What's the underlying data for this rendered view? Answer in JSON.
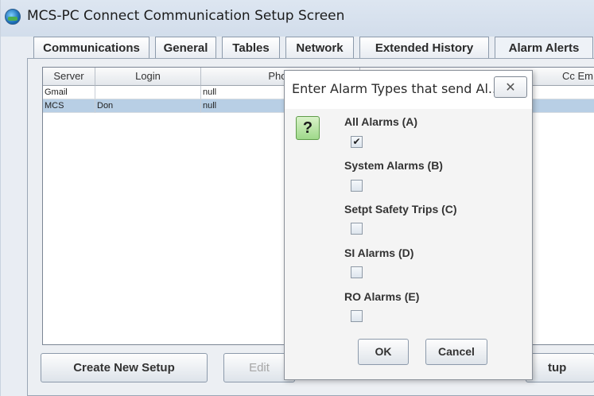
{
  "window": {
    "title": "MCS-PC Connect Communication Setup Screen",
    "icon": "app-globe-icon"
  },
  "tabs": [
    {
      "label": "Communications",
      "active": false
    },
    {
      "label": "General",
      "active": false
    },
    {
      "label": "Tables",
      "active": false
    },
    {
      "label": "Network",
      "active": false
    },
    {
      "label": "Extended History",
      "active": false
    },
    {
      "label": "Alarm Alerts",
      "active": true
    }
  ],
  "table": {
    "columns": [
      "Server",
      "Login",
      "Phon",
      "Cc Em"
    ],
    "rows": [
      {
        "server": "Gmail",
        "login": "",
        "phone": "null",
        "selected": false
      },
      {
        "server": "MCS",
        "login": "Don",
        "phone": "null",
        "selected": true
      }
    ]
  },
  "buttons": {
    "create_new_setup": "Create New Setup",
    "edit": "Edit",
    "setup_partial": "tup"
  },
  "dialog": {
    "title": "Enter Alarm Types that send Al...",
    "close_symbol": "✕",
    "question_symbol": "?",
    "options": [
      {
        "label": "All Alarms (A)",
        "checked": true
      },
      {
        "label": "System Alarms (B)",
        "checked": false
      },
      {
        "label": "Setpt Safety Trips (C)",
        "checked": false
      },
      {
        "label": "SI Alarms (D)",
        "checked": false
      },
      {
        "label": "RO Alarms (E)",
        "checked": false
      }
    ],
    "check_mark": "✔",
    "ok_label": "OK",
    "cancel_label": "Cancel"
  },
  "colors": {
    "selected_row": "#b8cfe5",
    "question_icon": "#9fd98a"
  }
}
